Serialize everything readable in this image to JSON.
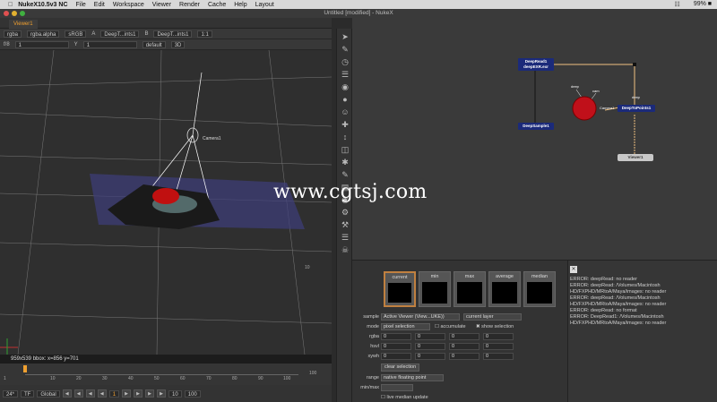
{
  "menubar": {
    "app": "NukeX10.5v3 NC",
    "items": [
      "File",
      "Edit",
      "Workspace",
      "Viewer",
      "Render",
      "Cache",
      "Help",
      "Layout"
    ],
    "status": "99% ■"
  },
  "window_title": "Untitled [modified] - NukeX",
  "viewer": {
    "tab": "Viewer1",
    "toolbar1": {
      "channels": "rgba",
      "channel": "rgba.alpha",
      "colorspace": "sRGB",
      "input_a_label": "A",
      "input_a": "DeepT...ints1",
      "input_b_label": "B",
      "input_b": "DeepT...ints1",
      "zoom": "1:1"
    },
    "toolbar2": {
      "fstop": "f/8",
      "gain": "1",
      "y_label": "Y",
      "gamma": "1",
      "lut": "default",
      "view_mode": "3D"
    },
    "camera_label": "Camera1",
    "grid_label": "10",
    "status": "959x539  bbox: x=856 y=701",
    "timeline": {
      "start": "1",
      "ticks": [
        "10",
        "20",
        "30",
        "40",
        "50",
        "60",
        "70",
        "80",
        "90"
      ],
      "end": "100",
      "end2": "100"
    },
    "playbar": {
      "fps": "24*",
      "tf": "TF",
      "scope": "Global",
      "frame": "1",
      "increment": "10",
      "end_frame": "100"
    }
  },
  "side_tools": [
    "arrow-icon",
    "draw-icon",
    "time-icon",
    "channel-icon",
    "color-icon",
    "filter-icon",
    "keyer-icon",
    "merge-icon",
    "transform-icon",
    "3d-icon",
    "views-icon",
    "metadata-icon",
    "deep-icon",
    "particles-icon",
    "toolsets-icon",
    "other-icon",
    "furnace-icon",
    "ofx-icon"
  ],
  "nodegraph": {
    "nodes": [
      {
        "id": "deepread",
        "label": "DeepRead1\ndeepEXR.exr"
      },
      {
        "id": "deepsample",
        "label": "DeepSample1"
      },
      {
        "id": "deeptopoints",
        "label": "DeepToPoints1"
      },
      {
        "id": "viewer",
        "label": "Viewer1"
      },
      {
        "id": "cam",
        "label": "Camera1"
      }
    ],
    "edge_labels": [
      "deep",
      "cam",
      "deep"
    ]
  },
  "watermark": "www.cgtsj.com",
  "deep_panel": {
    "swatches": [
      "current",
      "min",
      "max",
      "average",
      "median"
    ],
    "sample_label": "sample",
    "sample_value": "Active Viewer (View...UKE))",
    "layer_value": "current layer",
    "mode_label": "mode",
    "mode_value": "pixel selection",
    "accumulate": "accumulate",
    "show_selection": "show selection",
    "rgba_label": "rgba",
    "hsvl_label": "hsvl",
    "xywh_label": "xywh",
    "zero": "0",
    "clear_selection": "clear selection",
    "range_label": "range",
    "range_value": "native floating point",
    "minmax_label": "min/max",
    "live_median": "live median update"
  },
  "errors": [
    "ERROR: deepRead: no reader",
    "ERROR: deepRead: /Volumes/Macintosh HD/FXPHD/MRtoA/Maya/images: no reader",
    "ERROR: deepRead: /Volumes/Macintosh HD/FXPHD/MRtoA/Maya/images: no reader",
    "ERROR: deepRead: no format",
    "ERROR: DeepRead1: /Volumes/Macintosh HD/FXPHD/MRtoA/Maya/images: no reader"
  ],
  "colors": {
    "accent": "#f0a030",
    "read_node": "#1b2a7a",
    "camera_node": "#c0101a",
    "background": "#2b2b2b"
  }
}
